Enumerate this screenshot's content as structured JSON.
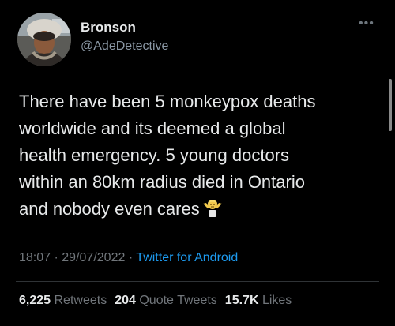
{
  "colors": {
    "background": "#000000",
    "text": "#e7e9ea",
    "secondary_text": "#71767b",
    "link": "#1d9bf0",
    "divider": "#2f3336"
  },
  "author": {
    "display_name": "Bronson",
    "handle": "@AdeDetective",
    "avatar_icon": "profile-photo-avatar"
  },
  "more_icon": "more-options-icon",
  "tweet": {
    "lines": [
      "There have been 5 monkeypox deaths",
      "worldwide and its deemed a global",
      "health emergency.  5 young doctors",
      "within an 80km radius died in Ontario",
      "and nobody even cares"
    ],
    "emoji_icon": "shrug-emoji-icon"
  },
  "meta": {
    "time": "18:07",
    "separator": "·",
    "date": "29/07/2022",
    "source": "Twitter for Android"
  },
  "stats": {
    "retweets_count": "6,225",
    "retweets_label": "Retweets",
    "quotes_count": "204",
    "quotes_label": "Quote Tweets",
    "likes_count": "15.7K",
    "likes_label": "Likes"
  }
}
